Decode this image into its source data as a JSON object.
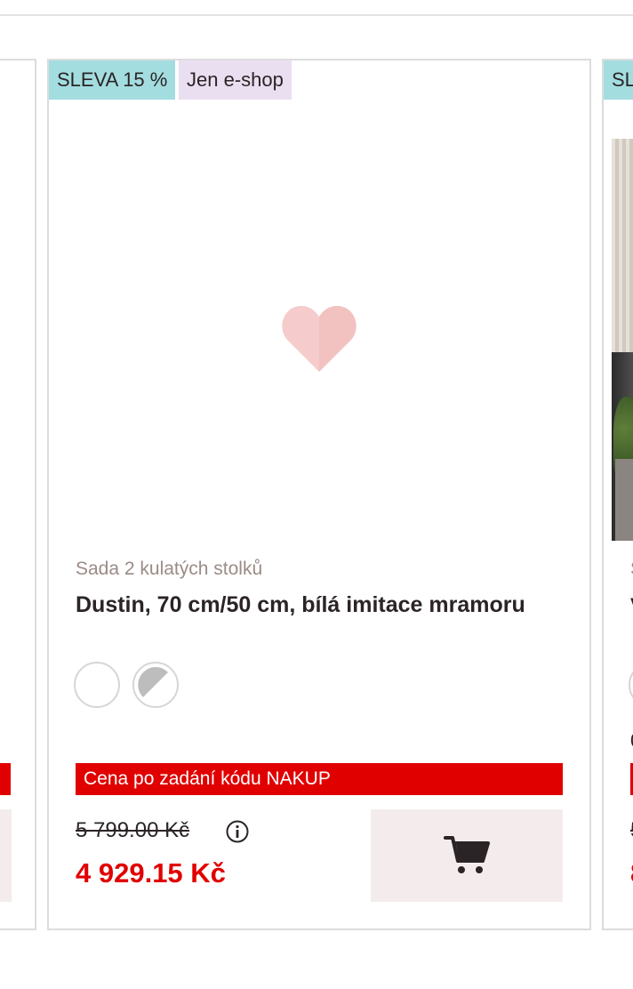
{
  "product": {
    "badge_sale": "SLEVA 15 %",
    "badge_eshop": "Jen e-shop",
    "category": "Sada 2 kulatých stolků",
    "title": "Dustin, 70 cm/50 cm, bílá imitace mramoru",
    "swatches": [
      {
        "name": "white",
        "color": "#ffffff"
      },
      {
        "name": "white-grey-marble",
        "color": "#bdbdbd"
      }
    ],
    "promo": "Cena po zadání kódu NAKUP",
    "old_price": "5 799.00 Kč",
    "new_price": "4 929.15 Kč",
    "info_icon": "info-icon",
    "cart_icon": "cart-icon",
    "placeholder_icon": "heart-icon"
  },
  "right_card": {
    "badge": "SLEVA",
    "category_fragment": "S",
    "title_fragment": "V",
    "misc_fragment": "0",
    "old_price_fragment": "5",
    "new_price_fragment": "8"
  },
  "colors": {
    "sale_badge": "#a3dde0",
    "eshop_badge": "#eadff0",
    "promo_red": "#e10000",
    "cart_bg": "#f4ecec",
    "heart": "#f5cccb"
  }
}
